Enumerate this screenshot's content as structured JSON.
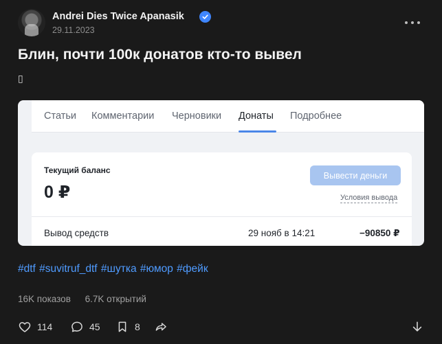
{
  "post": {
    "author": "Andrei Dies Twice Apanasik",
    "date": "29.11.2023",
    "title": "Блин, почти 100к донатов кто-то вывел",
    "glyph": "▯"
  },
  "screenshot": {
    "tabs": [
      {
        "label": "Статьи"
      },
      {
        "label": "Комментарии"
      },
      {
        "label": "Черновики"
      },
      {
        "label": "Донаты",
        "active": true
      },
      {
        "label": "Подробнее"
      }
    ],
    "balance_label": "Текущий баланс",
    "balance_value": "0 ₽",
    "withdraw_button": "Вывести деньги",
    "withdraw_terms": "Условия вывода",
    "transaction": {
      "label": "Вывод средств",
      "date": "29 нояб в 14:21",
      "amount": "−90850 ₽"
    }
  },
  "hashtags": [
    "#dtf",
    "#suvitruf_dtf",
    "#шутка",
    "#юмор",
    "#фейк"
  ],
  "stats": {
    "views": "16K показов",
    "opens": "6.7K открытий"
  },
  "actions": {
    "likes": "114",
    "comments": "45",
    "bookmarks": "8"
  },
  "colors": {
    "background": "#1a1a1a",
    "link": "#4f9bff",
    "verified": "#3f86ff",
    "button_disabled": "#a8c5f0",
    "tab_underline": "#4a86e8"
  }
}
